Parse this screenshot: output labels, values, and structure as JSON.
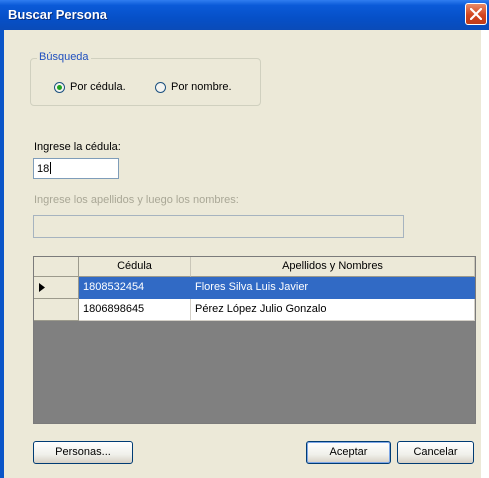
{
  "window": {
    "title": "Buscar Persona"
  },
  "search_group": {
    "legend": "Búsqueda",
    "options": [
      {
        "label": "Por cédula.",
        "selected": true
      },
      {
        "label": "Por nombre.",
        "selected": false
      }
    ]
  },
  "cedula": {
    "label": "Ingrese la cédula:",
    "value": "18"
  },
  "nombres": {
    "label": "Ingrese los apellidos y luego los nombres:",
    "value": ""
  },
  "grid": {
    "columns": [
      "Cédula",
      "Apellidos y Nombres"
    ],
    "rows": [
      {
        "cedula": "1808532454",
        "nombre": "Flores Silva Luis Javier",
        "selected": true
      },
      {
        "cedula": "1806898645",
        "nombre": "Pérez López Julio Gonzalo",
        "selected": false
      }
    ]
  },
  "buttons": {
    "personas": "Personas...",
    "aceptar": "Aceptar",
    "cancelar": "Cancelar"
  },
  "icons": {
    "close": "close-icon",
    "row_indicator": "row-pointer-icon"
  },
  "colors": {
    "title_bar": "#0650c8",
    "selection": "#316ac5",
    "radio_dot": "#21a121"
  }
}
